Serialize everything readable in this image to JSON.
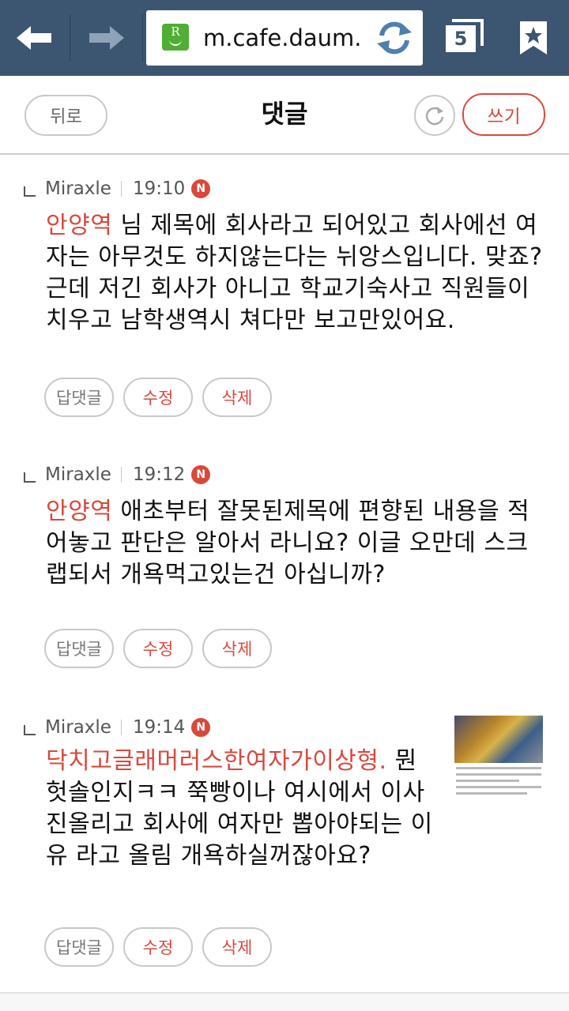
{
  "browser": {
    "url": "m.cafe.daum.",
    "tab_count": "5",
    "site_icon_letter": "R"
  },
  "header": {
    "back_label": "뒤로",
    "title": "댓글",
    "write_label": "쓰기"
  },
  "comments": [
    {
      "author": "Miraxle",
      "time": "19:10",
      "badge": "N",
      "mention": "안양역",
      "text": " 님 제목에 회사라고 되어있고 회사에선 여자는 아무것도 하지않는다는 뉘앙스입니다. 맞죠? 근데 저긴 회사가 아니고 학교기숙사고 직원들이 치우고 남학생역시 쳐다만 보고만있어요.",
      "actions": {
        "reply": "답댓글",
        "edit": "수정",
        "delete": "삭제"
      }
    },
    {
      "author": "Miraxle",
      "time": "19:12",
      "badge": "N",
      "mention": "안양역",
      "text": " 애초부터 잘못된제목에 편향된 내용을 적어놓고 판단은 알아서 라니요? 이글 오만데 스크랩되서 개욕먹고있는건 아십니까?",
      "actions": {
        "reply": "답댓글",
        "edit": "수정",
        "delete": "삭제"
      }
    },
    {
      "author": "Miraxle",
      "time": "19:14",
      "badge": "N",
      "mention": "닥치고글래머러스한여자가이상형.",
      "text": " 뭔헛솔인지ㅋㅋ 쭉빵이나 여시에서 이사진올리고 회사에 여자만 뽑아야되는 이유 라고 올림 개욕하실꺼잖아요?",
      "actions": {
        "reply": "답댓글",
        "edit": "수정",
        "delete": "삭제"
      }
    }
  ],
  "colors": {
    "browser_bar": "#3c5570",
    "accent_red": "#d9483b",
    "site_icon_green": "#4fae33"
  },
  "icons": [
    "back-arrow-icon",
    "forward-arrow-icon",
    "site-icon",
    "reload-icon",
    "tabs-icon",
    "bookmark-star-icon",
    "refresh-icon",
    "reply-indent-icon",
    "new-badge-icon"
  ]
}
